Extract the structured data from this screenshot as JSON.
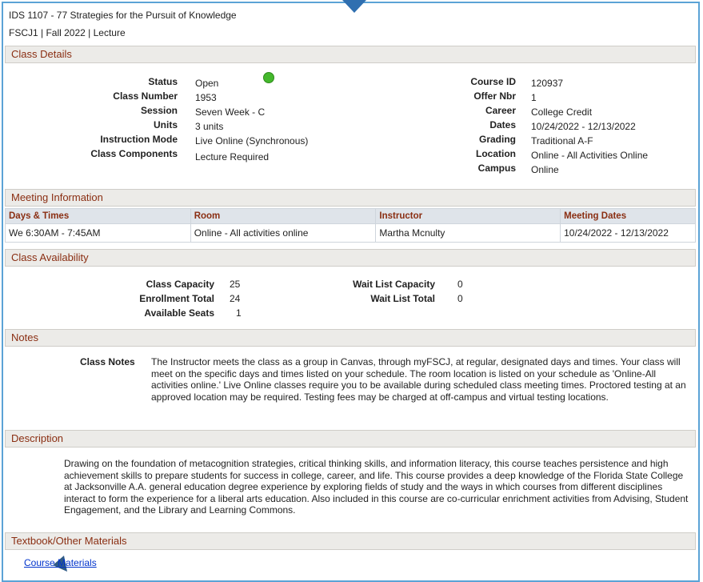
{
  "header": {
    "course_line": "IDS 1107 - 77   Strategies for the Pursuit of Knowledge",
    "term_line": "FSCJ1 | Fall 2022 | Lecture"
  },
  "class_details": {
    "title": "Class Details",
    "left": [
      {
        "label": "Status",
        "value": "Open"
      },
      {
        "label": "Class Number",
        "value": "1953"
      },
      {
        "label": "Session",
        "value": "Seven Week - C"
      },
      {
        "label": "Units",
        "value": "3 units"
      },
      {
        "label": "Instruction Mode",
        "value": "Live Online (Synchronous)"
      },
      {
        "label": "Class Components",
        "value": "Lecture Required"
      }
    ],
    "right": [
      {
        "label": "Course ID",
        "value": "120937"
      },
      {
        "label": "Offer Nbr",
        "value": "1"
      },
      {
        "label": "Career",
        "value": "College Credit"
      },
      {
        "label": "Dates",
        "value": "10/24/2022 - 12/13/2022"
      },
      {
        "label": "Grading",
        "value": "Traditional A-F"
      },
      {
        "label": "Location",
        "value": "Online - All Activities Online"
      },
      {
        "label": "Campus",
        "value": "Online"
      }
    ],
    "status_color": "#44b82c"
  },
  "meeting": {
    "title": "Meeting Information",
    "columns": [
      "Days & Times",
      "Room",
      "Instructor",
      "Meeting Dates"
    ],
    "rows": [
      [
        "We 6:30AM - 7:45AM",
        "Online - All activities online",
        "Martha Mcnulty",
        "10/24/2022 - 12/13/2022"
      ]
    ]
  },
  "availability": {
    "title": "Class Availability",
    "left": [
      {
        "label": "Class Capacity",
        "value": "25"
      },
      {
        "label": "Enrollment Total",
        "value": "24"
      },
      {
        "label": "Available Seats",
        "value": "1"
      }
    ],
    "right": [
      {
        "label": "Wait List Capacity",
        "value": "0"
      },
      {
        "label": "Wait List Total",
        "value": "0"
      }
    ]
  },
  "notes": {
    "title": "Notes",
    "label": "Class Notes",
    "text": "The Instructor meets the class as a group in Canvas, through myFSCJ, at regular, designated days and times. Your class will meet on the specific days and times listed on your schedule. The room location is listed on your schedule as 'Online-All activities online.' Live Online classes require you to be available during scheduled class meeting times. Proctored testing at an approved location may be required. Testing fees may be charged at off-campus and virtual testing locations."
  },
  "description": {
    "title": "Description",
    "text": "Drawing on the foundation of metacognition strategies, critical thinking skills, and information literacy, this course teaches persistence and high achievement skills to prepare students for success in college, career, and life. This course provides a deep knowledge of the Florida State College at Jacksonville A.A. general education degree experience by exploring fields of study and the ways in which courses from different disciplines interact to form the experience for a liberal arts education. Also included in this course are co-curricular enrichment activities from Advising, Student Engagement, and the Library and Learning Commons."
  },
  "materials": {
    "title": "Textbook/Other Materials",
    "link_label": "Course Materials"
  },
  "colors": {
    "frame": "#5ba3d6",
    "section_text": "#8a2e12",
    "link": "#0033cc"
  },
  "icons": [
    "status-open-icon",
    "arrow-down-icon",
    "arrow-up-icon"
  ]
}
